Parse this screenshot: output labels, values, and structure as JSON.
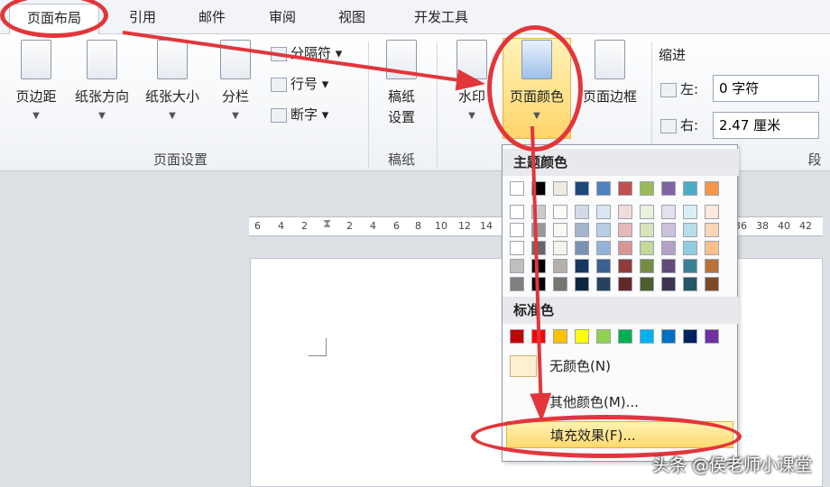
{
  "tabs": [
    "页面布局",
    "引用",
    "邮件",
    "审阅",
    "视图",
    "开发工具"
  ],
  "page_setup_group": {
    "margins": "页边距",
    "orientation": "纸张方向",
    "size": "纸张大小",
    "columns": "分栏",
    "breaks": "分隔符",
    "line_numbers": "行号",
    "hyphenation": "断字",
    "label": "页面设置"
  },
  "manuscript_group": {
    "button_line1": "稿纸",
    "button_line2": "设置",
    "label": "稿纸"
  },
  "background_group": {
    "watermark": "水印",
    "page_color": "页面颜色",
    "page_borders": "页面边框"
  },
  "indent": {
    "title": "缩进",
    "left_label": "左:",
    "left_value": "0 字符",
    "right_label": "右:",
    "right_value": "2.47 厘米",
    "cut_label": "段"
  },
  "ruler_ticks": [
    "6",
    "4",
    "2",
    "2",
    "4",
    "6",
    "8",
    "10",
    "12",
    "14",
    "36",
    "38",
    "40",
    "42"
  ],
  "dropdown": {
    "theme_colors_title": "主题颜色",
    "standard_colors_title": "标准色",
    "no_color": "无颜色(N)",
    "more_colors": "其他颜色(M)...",
    "fill_effects": "填充效果(F)..."
  },
  "theme_colors": [
    "#ffffff",
    "#000000",
    "#eeece1",
    "#1f497d",
    "#4f81bd",
    "#c0504d",
    "#9bbb59",
    "#8064a2",
    "#4bacc6",
    "#f79646"
  ],
  "standard_colors": [
    "#c00000",
    "#ff0000",
    "#ffc000",
    "#ffff00",
    "#92d050",
    "#00b050",
    "#00b0f0",
    "#0070c0",
    "#002060",
    "#7030a0"
  ],
  "watermark_text": "头条 @侯老师小课堂"
}
